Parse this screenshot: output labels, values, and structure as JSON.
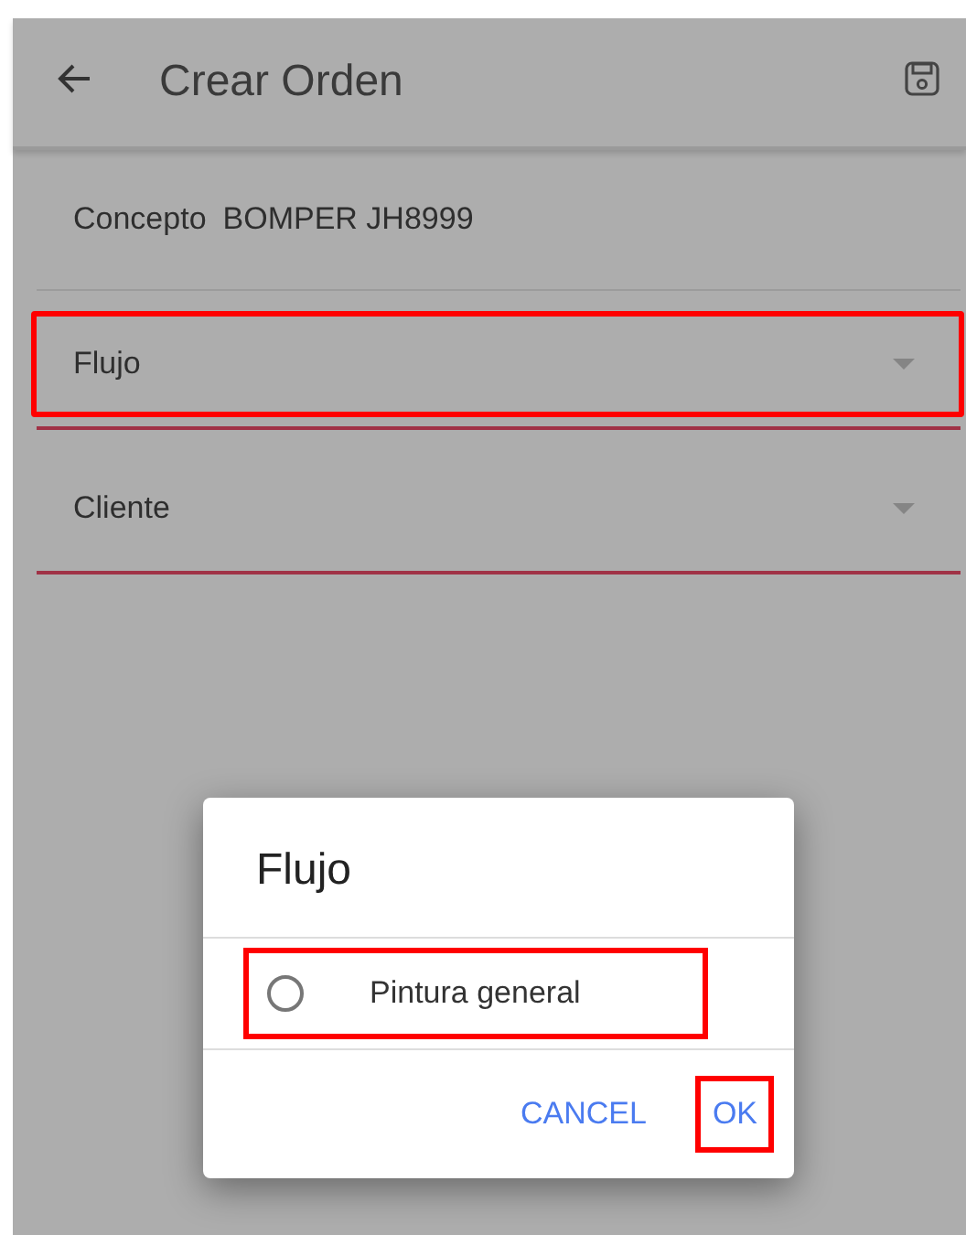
{
  "app_bar": {
    "title": "Crear Orden"
  },
  "concepto": {
    "label": "Concepto",
    "value": "BOMPER JH8999"
  },
  "fields": [
    {
      "label": "Flujo",
      "highlighted": true
    },
    {
      "label": "Cliente",
      "highlighted": false
    }
  ],
  "dialog": {
    "title": "Flujo",
    "options": [
      {
        "label": "Pintura general",
        "selected": false,
        "highlighted": true
      }
    ],
    "buttons": [
      {
        "label": "CANCEL",
        "highlighted": false
      },
      {
        "label": "OK",
        "highlighted": true
      }
    ]
  }
}
